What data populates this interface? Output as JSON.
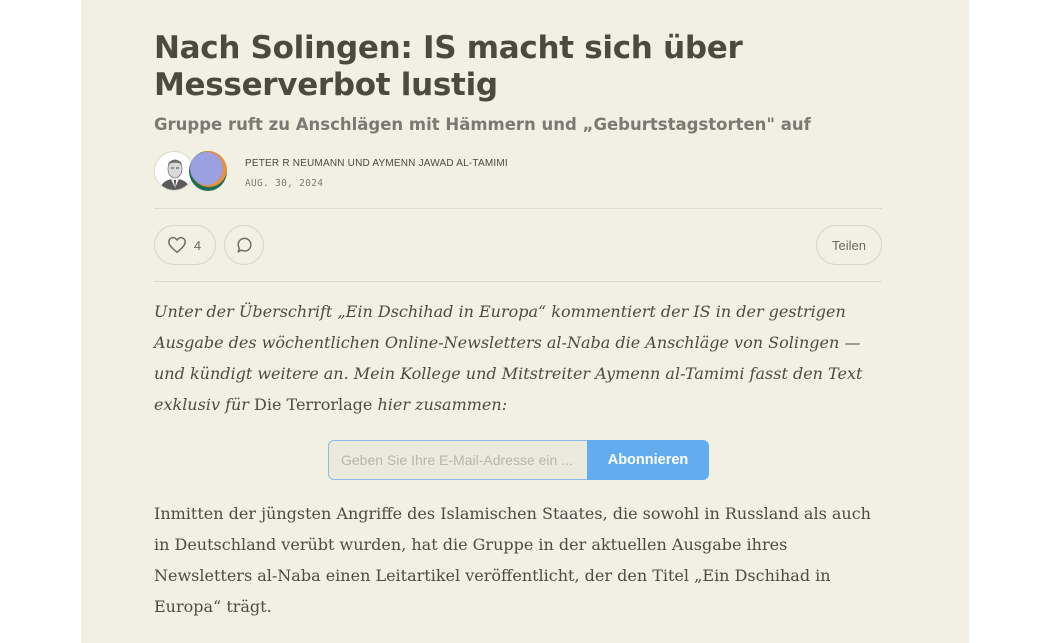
{
  "article": {
    "title": "Nach Solingen: IS macht sich über Messerverbot lustig",
    "subtitle": "Gruppe ruft zu Anschlägen mit Hämmern und „Geburtstagstorten\" auf",
    "authors": "PETER R NEUMANN UND AYMENN JAWAD AL-TAMIMI",
    "date": "AUG. 30, 2024"
  },
  "actions": {
    "like_count": "4",
    "share_label": "Teilen"
  },
  "intro": {
    "part1": "Unter der Überschrift „Ein Dschihad in Europa“ kommentiert der IS in der gestrigen Ausgabe des wöchentlichen Online-Newsletters al-Naba die Anschläge von Solingen — und kündigt weitere an. Mein Kollege und Mitstreiter Aymenn al-Tamimi fasst den Text exklusiv für ",
    "part2": "Die Terrorlage",
    "part3": " hier zusammen:"
  },
  "subscribe": {
    "placeholder": "Geben Sie Ihre E-Mail-Adresse ein ...",
    "button_label": "Abonnieren",
    "accent_color": "#62adf0"
  },
  "body": {
    "paragraph1": "Inmitten der jüngsten Angriffe des Islamischen Staates, die sowohl in Russland als auch in Deutschland verübt wurden, hat die Gruppe in der aktuellen Ausgabe ihres Newsletters al-Naba einen Leitartikel veröffentlicht, der den Titel „Ein Dschihad in Europa“ trägt."
  },
  "icons": {
    "like": "heart-icon",
    "comment": "comment-bubble-icon"
  }
}
